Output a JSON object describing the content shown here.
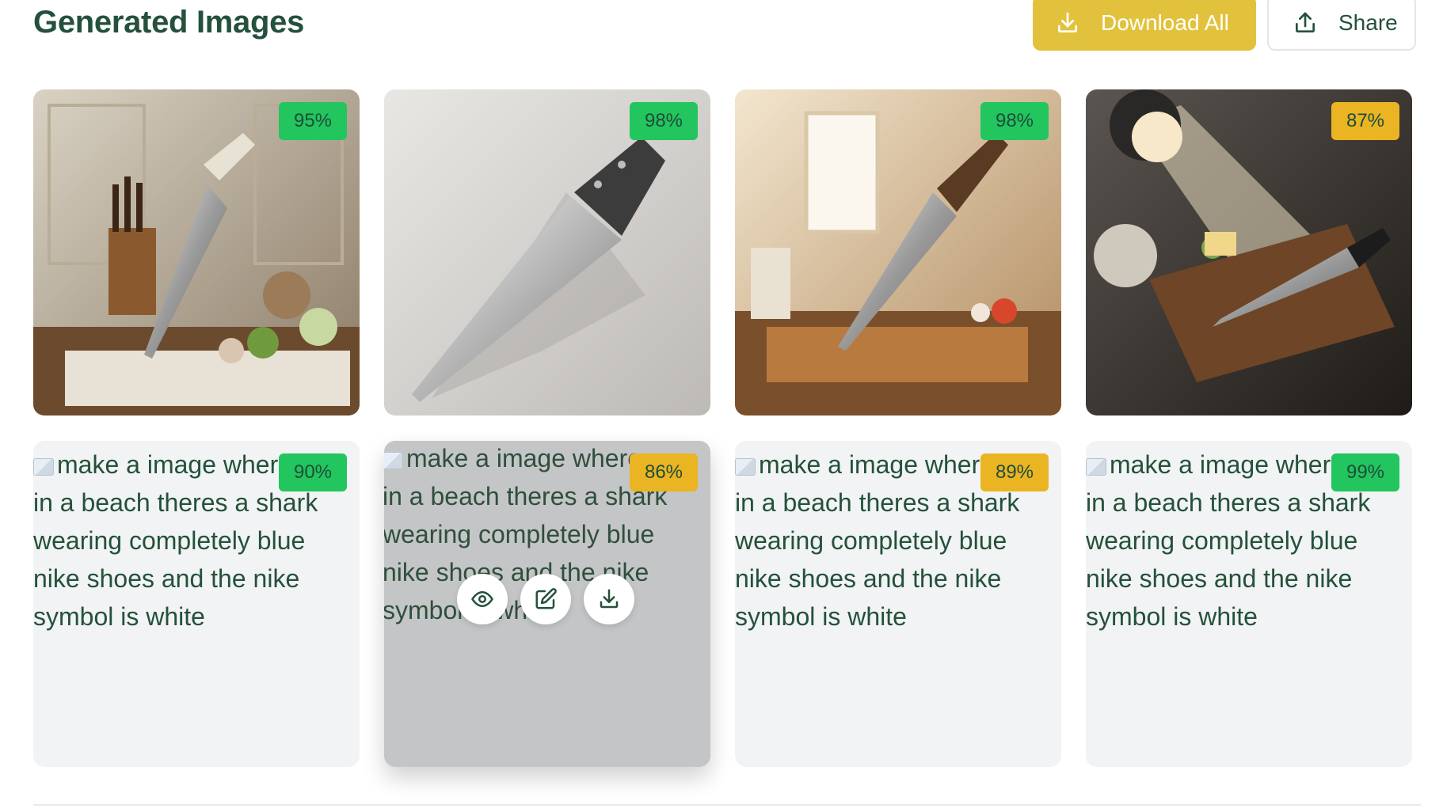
{
  "header": {
    "title": "Generated Images",
    "download_all_label": "Download All",
    "share_label": "Share"
  },
  "colors": {
    "accent_button": "#e2c23c",
    "score_green": "#22c55e",
    "score_amber": "#eab423",
    "text_green": "#24513b"
  },
  "images": [
    {
      "score": "95%",
      "tone": "green",
      "subject": "chef knife on marble cutting board in classic kitchen"
    },
    {
      "score": "98%",
      "tone": "green",
      "subject": "chef knife on plain light background"
    },
    {
      "score": "98%",
      "tone": "green",
      "subject": "chef knife on wooden board in sunny kitchen"
    },
    {
      "score": "87%",
      "tone": "amber",
      "subject": "knife on cutting board under spotlight with vegetables"
    },
    {
      "score": "90%",
      "tone": "green",
      "alt": "make a image where in a beach theres a shark wearing completely blue nike shoes and the nike symbol is white"
    },
    {
      "score": "86%",
      "tone": "amber",
      "alt": "make a image where in a beach theres a shark wearing completely blue nike shoes and the nike symbol is white"
    },
    {
      "score": "89%",
      "tone": "amber",
      "alt": "make a image where in a beach theres a shark wearing completely blue nike shoes and the nike symbol is white"
    },
    {
      "score": "99%",
      "tone": "green",
      "alt": "make a image where in a beach theres a shark wearing completely blue nike shoes and the nike symbol is white"
    }
  ],
  "hover_actions": [
    "eye-icon",
    "edit-icon",
    "download-icon"
  ]
}
